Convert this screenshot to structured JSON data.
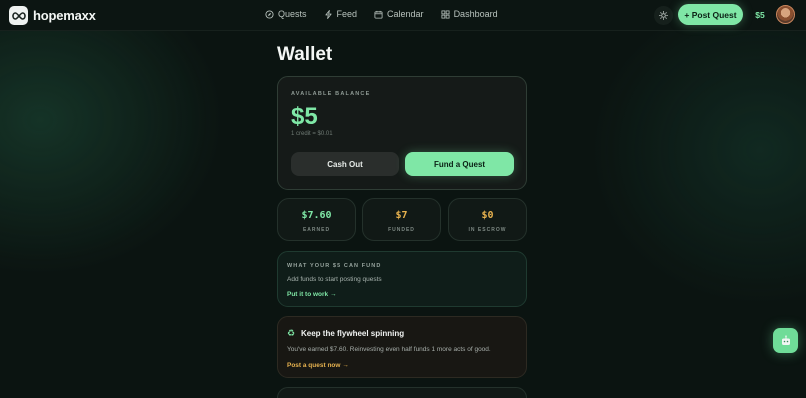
{
  "brand": {
    "name": "hopemaxx",
    "logo_icon": "infinity-icon"
  },
  "nav": [
    {
      "label": "Quests",
      "icon": "compass-icon"
    },
    {
      "label": "Feed",
      "icon": "bolt-icon"
    },
    {
      "label": "Calendar",
      "icon": "calendar-icon"
    },
    {
      "label": "Dashboard",
      "icon": "grid-icon"
    }
  ],
  "header": {
    "theme_icon": "sun-icon",
    "post_label": "+ Post Quest",
    "credit": "$5"
  },
  "page": {
    "title": "Wallet"
  },
  "balance": {
    "label": "AVAILABLE BALANCE",
    "amount": "$5",
    "rate": "1 credit = $0.01",
    "cashout_label": "Cash Out",
    "fund_label": "Fund a Quest"
  },
  "stats": [
    {
      "value": "$7.60",
      "label": "EARNED",
      "color": "#7fe7a6"
    },
    {
      "value": "$7",
      "label": "FUNDED",
      "color": "#e7b24f"
    },
    {
      "value": "$0",
      "label": "IN ESCROW",
      "color": "#e7b24f"
    }
  ],
  "fund_card": {
    "title": "WHAT YOUR $5 CAN FUND",
    "text": "Add funds to start posting quests",
    "link": "Put it to work →"
  },
  "flywheel": {
    "icon": "recycle-icon",
    "title": "Keep the flywheel spinning",
    "text": "You've earned $7.60. Reinvesting even half funds 1 more acts of good.",
    "link": "Post a quest now →"
  },
  "colors": {
    "accent": "#7fe7a6",
    "amber": "#e7b24f",
    "background": "#0b1411"
  }
}
